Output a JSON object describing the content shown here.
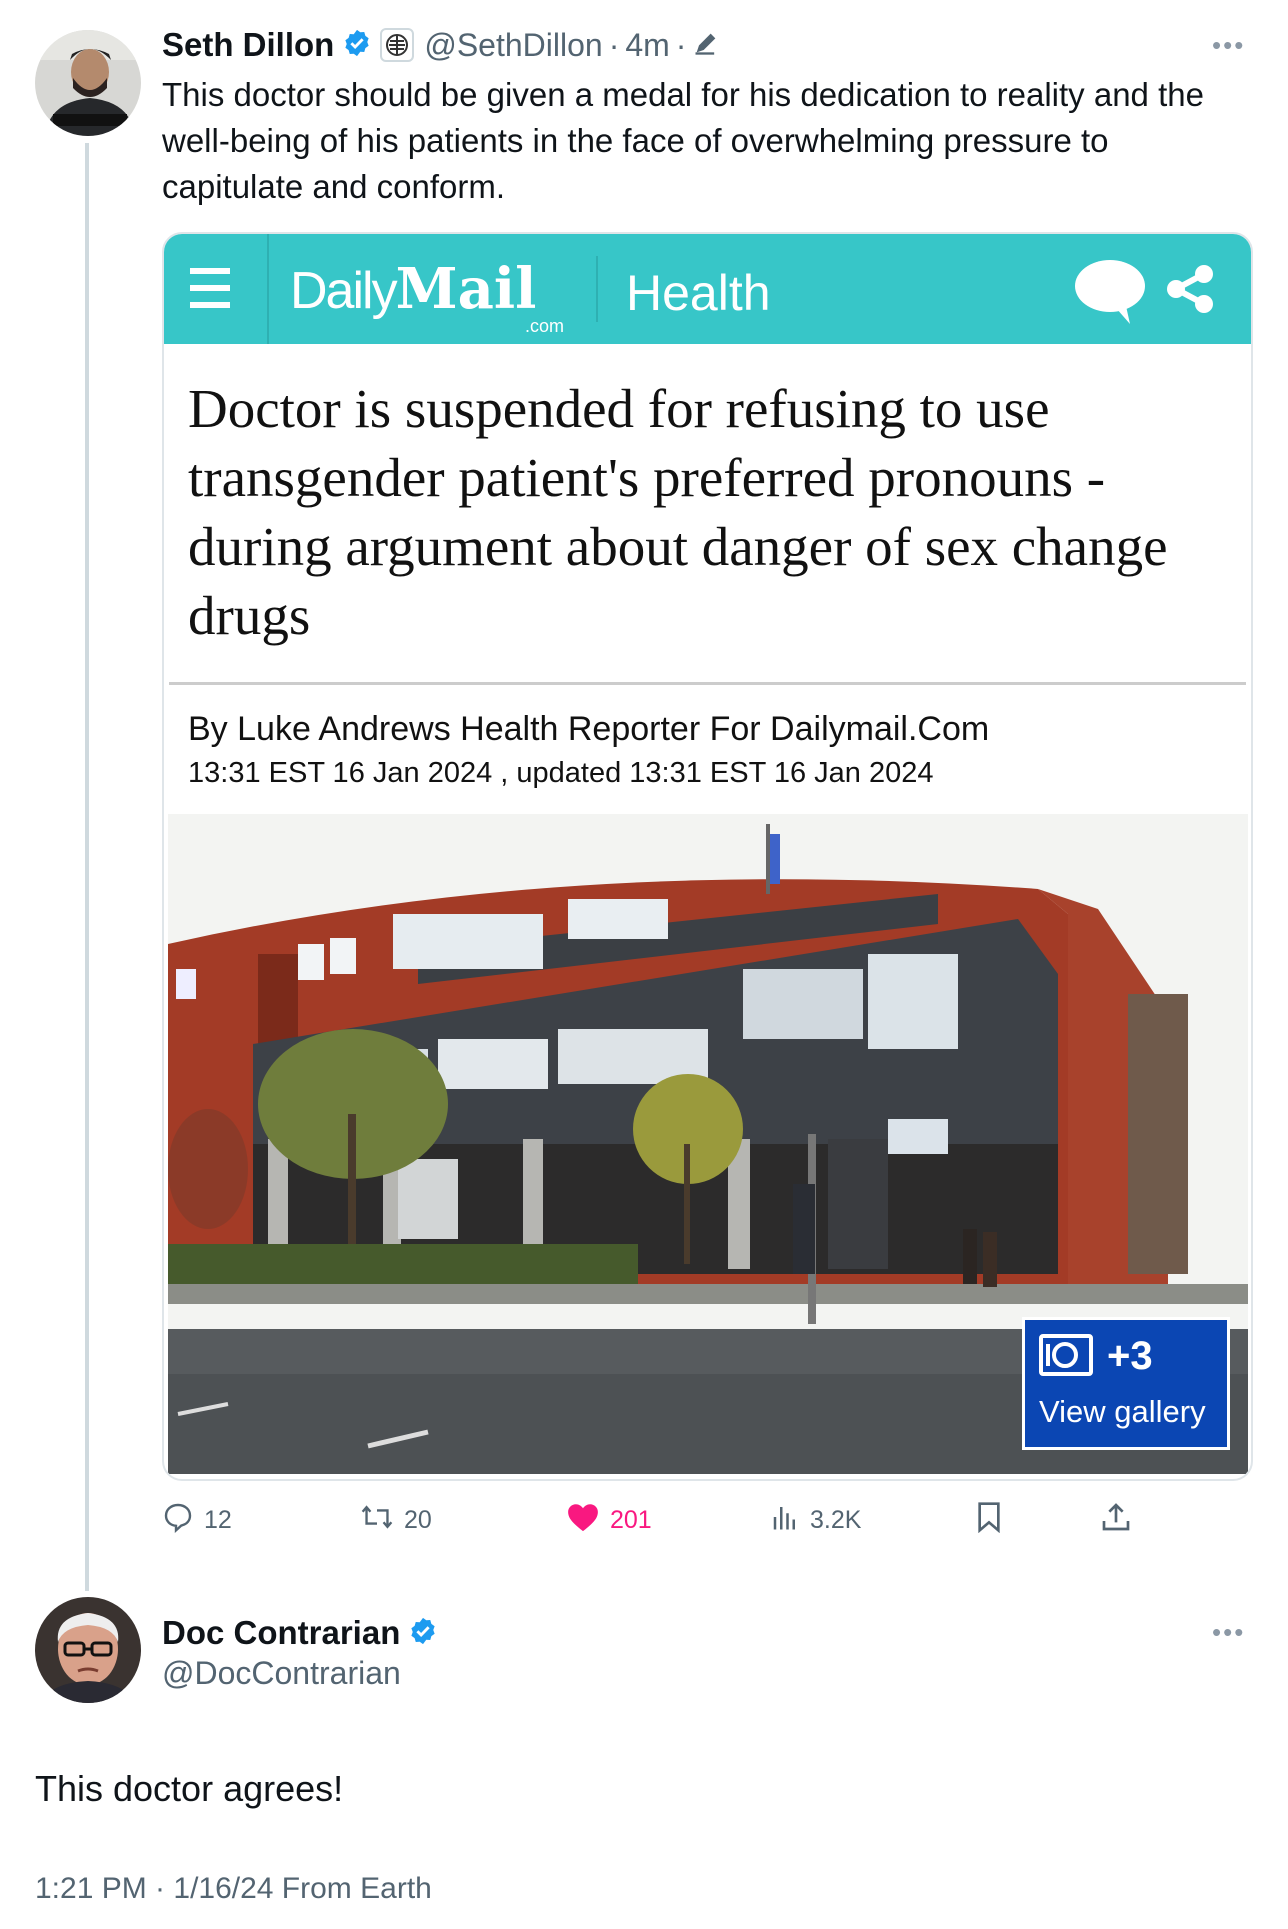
{
  "tweet1": {
    "name": "Seth Dillon",
    "handle": "@SethDillon",
    "time": "4m",
    "separator": "·",
    "text": "This doctor should be given a medal for his dedication to reality and the well-being of his patients in the face of overwhelming pressure to capitulate and conform.",
    "card": {
      "brand_daily": "Daily",
      "brand_mail": "Mail",
      "brand_com": ".com",
      "section": "Health",
      "headline": "Doctor is suspended for refusing to use transgender patient's preferred pronouns - during argument about danger of sex change drugs",
      "byline": "By Luke Andrews Health Reporter For Dailymail.Com",
      "dateline": "13:31 EST 16 Jan 2024 , updated 13:31 EST 16 Jan 2024",
      "gallery_count": "+3",
      "gallery_label": "View gallery"
    },
    "actions": {
      "replies": "12",
      "reposts": "20",
      "likes": "201",
      "views": "3.2K"
    }
  },
  "tweet2": {
    "name": "Doc Contrarian",
    "handle": "@DocContrarian",
    "text": "This doctor agrees!",
    "timestamp": "1:21 PM · 1/16/24 From Earth"
  },
  "colors": {
    "verified": "#1d9bf0",
    "like": "#f91880",
    "dailymail_teal": "#37c6c8",
    "gallery_blue": "#0b46b3"
  },
  "icons": [
    "verified-badge-icon",
    "affiliate-badge-icon",
    "edit-pencil-icon",
    "more-icon",
    "menu-icon",
    "comment-bubble-icon",
    "share-icon",
    "camera-icon",
    "reply-icon",
    "repost-icon",
    "like-heart-icon",
    "views-icon",
    "bookmark-icon",
    "share-upload-icon"
  ]
}
